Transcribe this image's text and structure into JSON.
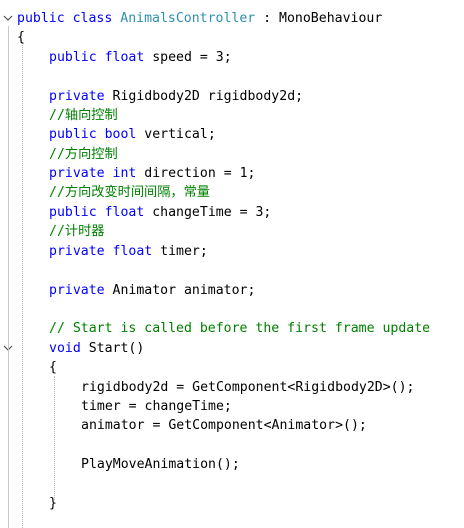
{
  "colors": {
    "keyword": "#0000ff",
    "type": "#2b91af",
    "comment": "#008000",
    "text": "#000000",
    "background": "#ffffff"
  },
  "code": {
    "line1": {
      "kw1": "public",
      "kw2": "class",
      "class_name": "AnimalsController",
      "rest": " : MonoBehaviour"
    },
    "line2": {
      "brace": "{"
    },
    "line3": {
      "kw1": "public",
      "kw2": "float",
      "rest": " speed = 3;"
    },
    "line5": {
      "kw1": "private",
      "rest": " Rigidbody2D rigidbody2d;"
    },
    "line6": {
      "comment": "//轴向控制"
    },
    "line7": {
      "kw1": "public",
      "kw2": "bool",
      "rest": " vertical;"
    },
    "line8": {
      "comment": "//方向控制"
    },
    "line9": {
      "kw1": "private",
      "kw2": "int",
      "rest": " direction = 1;"
    },
    "line10": {
      "comment": "//方向改变时间间隔，常量"
    },
    "line11": {
      "kw1": "public",
      "kw2": "float",
      "rest": " changeTime = 3;"
    },
    "line12": {
      "comment": "//计时器"
    },
    "line13": {
      "kw1": "private",
      "kw2": "float",
      "rest": " timer;"
    },
    "line15": {
      "kw1": "private",
      "rest": " Animator animator;"
    },
    "line17": {
      "comment": "// Start is called before the first frame update"
    },
    "line18": {
      "kw1": "void",
      "rest": " Start()"
    },
    "line19": {
      "brace": "{"
    },
    "line20": {
      "rest": "rigidbody2d = GetComponent<Rigidbody2D>();"
    },
    "line21": {
      "rest": "timer = changeTime;"
    },
    "line22": {
      "rest": "animator = GetComponent<Animator>();"
    },
    "line24": {
      "rest": "PlayMoveAnimation();"
    },
    "line26": {
      "brace": "}"
    }
  }
}
